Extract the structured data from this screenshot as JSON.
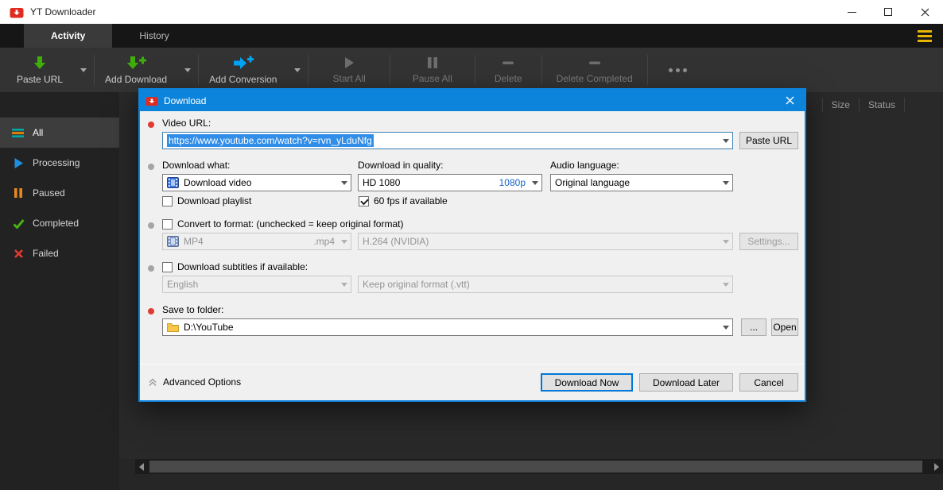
{
  "window": {
    "title": "YT Downloader"
  },
  "tabs": [
    {
      "label": "Activity"
    },
    {
      "label": "History"
    }
  ],
  "toolbar": {
    "paste_url": "Paste URL",
    "add_download": "Add Download",
    "add_conversion": "Add Conversion",
    "start_all": "Start All",
    "pause_all": "Pause All",
    "delete": "Delete",
    "delete_completed": "Delete Completed"
  },
  "sidebar": {
    "items": [
      {
        "label": "All"
      },
      {
        "label": "Processing"
      },
      {
        "label": "Paused"
      },
      {
        "label": "Completed"
      },
      {
        "label": "Failed"
      }
    ]
  },
  "list": {
    "columns": [
      "Size",
      "Status"
    ]
  },
  "dialog": {
    "title": "Download",
    "video_url_label": "Video URL:",
    "video_url_value": "https://www.youtube.com/watch?v=rvn_yLduNfg",
    "paste_url_button": "Paste URL",
    "download_what_label": "Download what:",
    "download_what_value": "Download video",
    "quality_label": "Download in quality:",
    "quality_value": "HD 1080",
    "quality_tag": "1080p",
    "audio_label": "Audio language:",
    "audio_value": "Original language",
    "playlist_checkbox": "Download playlist",
    "fps_checkbox": "60 fps if available",
    "convert_checkbox": "Convert to format: (unchecked = keep original format)",
    "format_value": "MP4",
    "format_ext": ".mp4",
    "codec_value": "H.264 (NVIDIA)",
    "settings_button": "Settings...",
    "subtitles_checkbox": "Download subtitles if available:",
    "subtitles_language": "English",
    "subtitles_format": "Keep original format (.vtt)",
    "save_label": "Save to folder:",
    "save_path": "D:\\YouTube",
    "browse_button": "...",
    "open_button": "Open",
    "advanced_options": "Advanced Options",
    "download_now_button": "Download Now",
    "download_later_button": "Download Later",
    "cancel_button": "Cancel"
  },
  "colors": {
    "accent_blue": "#0d84dc",
    "green": "#3fae0a",
    "red": "#e03c31",
    "orange": "#e8871e",
    "menu_gold": "#e7b400"
  }
}
